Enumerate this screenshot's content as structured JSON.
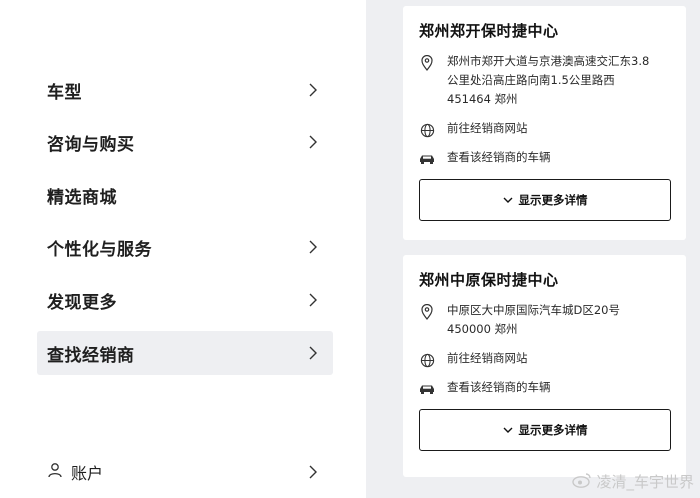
{
  "nav": {
    "items": [
      {
        "label": "车型",
        "active": false
      },
      {
        "label": "咨询与购买",
        "active": false
      },
      {
        "label": "精选商城",
        "active": false
      },
      {
        "label": "个性化与服务",
        "active": false
      },
      {
        "label": "发现更多",
        "active": false
      },
      {
        "label": "查找经销商",
        "active": true
      }
    ],
    "account_label": "账户"
  },
  "dealers": [
    {
      "name": "郑州郑开保时捷中心",
      "address_lines": [
        "郑州市郑开大道与京港澳高速交汇东3.8",
        "公里处沿高庄路向南1.5公里路西",
        "451464 郑州"
      ],
      "website_label": "前往经销商网站",
      "vehicles_label": "查看该经销商的车辆",
      "details_button": "显示更多详情"
    },
    {
      "name": "郑州中原保时捷中心",
      "address_lines": [
        "中原区大中原国际汽车城D区20号",
        "450000 郑州"
      ],
      "website_label": "前往经销商网站",
      "vehicles_label": "查看该经销商的车辆",
      "details_button": "显示更多详情"
    }
  ],
  "watermark": "凌清_车宇世界",
  "colors": {
    "panel_bg": "#eeeff2",
    "active_item_bg": "#eeeff2",
    "text": "#1a1a1a"
  }
}
